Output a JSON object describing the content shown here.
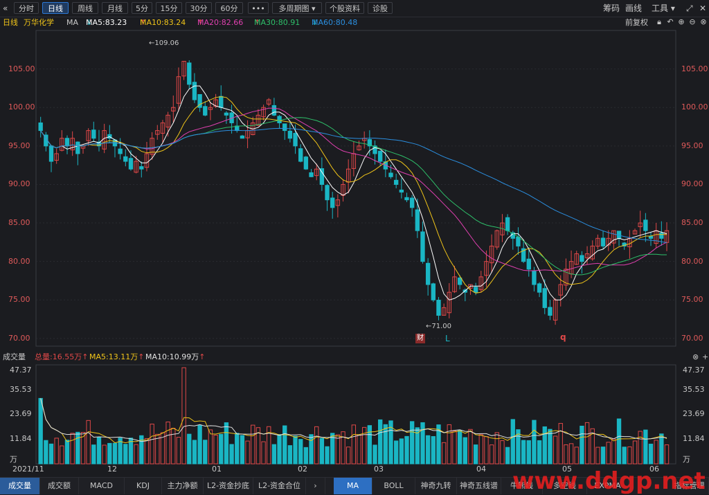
{
  "toolbar": {
    "back_icon": "double-chevron-left-icon",
    "periods": [
      "分时",
      "日线",
      "周线",
      "月线",
      "5分",
      "15分",
      "30分",
      "60分"
    ],
    "active": "日线",
    "more": "•••",
    "multi_period": "多周期图",
    "stock_info": "个股资料",
    "diagnose": "诊股",
    "right": {
      "chips": "筹码",
      "draw": "画线",
      "tools": "工具"
    }
  },
  "ma_bar": {
    "period": "日线",
    "stock": "万华化学",
    "ma": "MA",
    "ma5": "MA5:83.23",
    "ma10": "MA10:83.24",
    "ma20": "MA20:82.66",
    "ma30": "MA30:80.91",
    "ma60": "MA60:80.48",
    "adjust": "前复权"
  },
  "colors": {
    "up": "#e04848",
    "down": "#1ab6c4",
    "ma5": "#ffffff",
    "ma10": "#f0c419",
    "ma20": "#e040b0",
    "ma30": "#2ec06a",
    "ma60": "#2b8fe0",
    "axis_price": "#e05a5a"
  },
  "price_axis": {
    "left": [
      "105.00",
      "100.00",
      "95.00",
      "90.00",
      "85.00",
      "80.00",
      "75.00",
      "70.00"
    ],
    "right": [
      "105.00",
      "100.00",
      "95.00",
      "90.00",
      "85.00",
      "80.00",
      "75.00",
      "70.00"
    ]
  },
  "annotations": {
    "high": "109.06",
    "low": "71.00",
    "markers": [
      "财",
      "L",
      "q"
    ]
  },
  "volume": {
    "title": "成交量",
    "total": "总量:16.55万",
    "ma5": "MA5:13.11万",
    "ma10": "MA10:10.99万",
    "axis": [
      "47.37",
      "35.53",
      "23.69",
      "11.84",
      "万"
    ]
  },
  "dates": [
    "2021/11",
    "12",
    "01",
    "02",
    "03",
    "04",
    "05",
    "06"
  ],
  "bottom_left_tabs": [
    "成交量",
    "成交额",
    "MACD",
    "KDJ",
    "主力净额",
    "L2-资金抄底",
    "L2-资金合位"
  ],
  "bottom_right_tabs": [
    "MA",
    "BOLL",
    "神奇九转",
    "神奇五线谱",
    "牛熊线",
    "多空线",
    "EXPMA",
    "指标管理"
  ],
  "watermark": "www.ddgp.net",
  "chart_data": {
    "type": "candlestick",
    "ylim": [
      69,
      110
    ],
    "closes": [
      97,
      95,
      93,
      94,
      96,
      95,
      96,
      94,
      95,
      97,
      96,
      95,
      97,
      96,
      95,
      94,
      93,
      92,
      93,
      92,
      94,
      96,
      97,
      98,
      99,
      100,
      104,
      106,
      103,
      101,
      100,
      99,
      100,
      101,
      100,
      99,
      98,
      97,
      96,
      97,
      98,
      99,
      100,
      101,
      99,
      98,
      97,
      96,
      95,
      93,
      92,
      91,
      92,
      90,
      88,
      87,
      88,
      90,
      92,
      94,
      95,
      96,
      95,
      94,
      93,
      92,
      91,
      90,
      89,
      88,
      87,
      84,
      80,
      77,
      75,
      73,
      74,
      76,
      78,
      77,
      76,
      77,
      76,
      78,
      80,
      82,
      84,
      85,
      84,
      83,
      82,
      80,
      79,
      77,
      76,
      74,
      73,
      75,
      77,
      79,
      80,
      81,
      80,
      81,
      82,
      83,
      82,
      83,
      84,
      83,
      82,
      83,
      84,
      85,
      84,
      83,
      84,
      83,
      84
    ],
    "ma5_last": 83.23,
    "ma10_last": 83.24,
    "ma20_last": 82.66,
    "ma30_last": 80.91,
    "ma60_last": 80.48
  }
}
